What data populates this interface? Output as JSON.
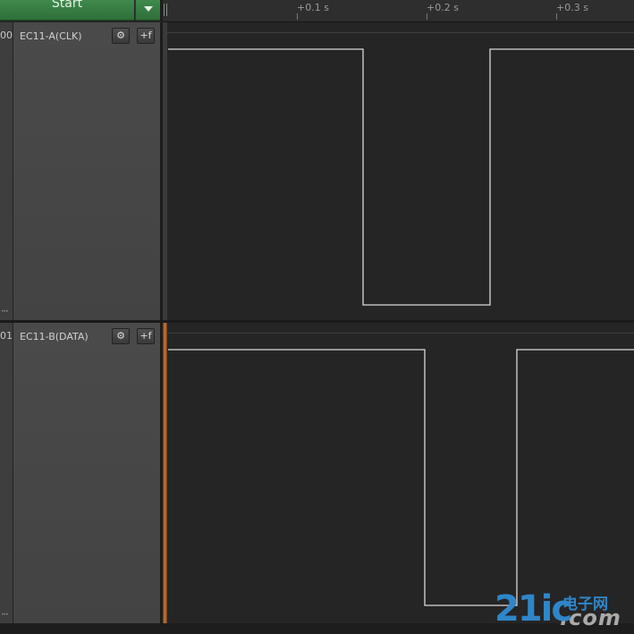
{
  "toolbar": {
    "start_label": "Start",
    "start_dropdown_icon": "triangle-down-icon"
  },
  "ruler": {
    "ticks": [
      "+0.1 s",
      "+0.2 s",
      "+0.3 s"
    ]
  },
  "channels": [
    {
      "index": "00",
      "name": "EC11-A(CLK)",
      "settings_icon": "gear-icon",
      "trigger_icon": "add-trigger-icon",
      "trigger_label": "+f"
    },
    {
      "index": "01",
      "name": "EC11-B(DATA)",
      "settings_icon": "gear-icon",
      "trigger_icon": "add-trigger-icon",
      "trigger_label": "+f"
    }
  ],
  "colors": {
    "start_button": "#3a7f47",
    "waveform": "#d9d9d9",
    "background": "#252525",
    "selected_channel_marker": "#c97a3a"
  },
  "watermark": {
    "brand": "21ic",
    "cn": "电子网",
    "domain": ".com"
  }
}
